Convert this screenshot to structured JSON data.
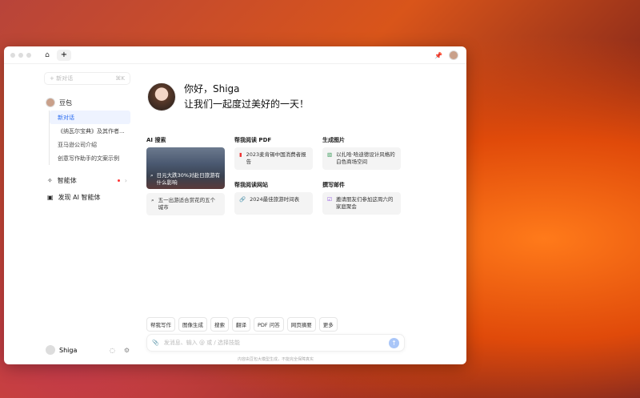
{
  "titlebar": {
    "home_icon": "home-icon",
    "new_tab": "+"
  },
  "sidebar": {
    "new_chat": "新对话",
    "shortcut": "⌘K",
    "bot_name": "豆包",
    "history": [
      "新对话",
      "《纳瓦尔宝典》及其作者...",
      "亚马逊公司介绍",
      "创意写作助手的文案示例"
    ],
    "agents": "智能体",
    "discover": "发现 AI 智能体",
    "user": "Shiga"
  },
  "hero": {
    "greeting": "你好，Shiga",
    "subtitle": "让我们一起度过美好的一天！"
  },
  "sections": {
    "ai_search": {
      "title": "AI 搜索",
      "image_card": "日元大跌30%对赴日旅游有什么影响",
      "card": "五一出游适合赏花的五个城市"
    },
    "pdf": {
      "title": "帮我阅读 PDF",
      "card": "2023麦肯锡中国消费者报告"
    },
    "image": {
      "title": "生成图片",
      "card": "以扎哈·哈迪德设计风格的白色商场空间"
    },
    "web": {
      "title": "帮我阅读网站",
      "card": "2024最佳旅游时间表"
    },
    "mail": {
      "title": "撰写邮件",
      "card": "邀请朋友们参加这周六的家庭聚会"
    }
  },
  "tools": [
    "帮我写作",
    "图像生成",
    "搜索",
    "翻译",
    "PDF 问答",
    "网页摘要",
    "更多"
  ],
  "input": {
    "placeholder": "发消息、输入 @ 或 / 选择技能"
  },
  "footer": "内容由豆包大模型生成，不能完全保障真实"
}
